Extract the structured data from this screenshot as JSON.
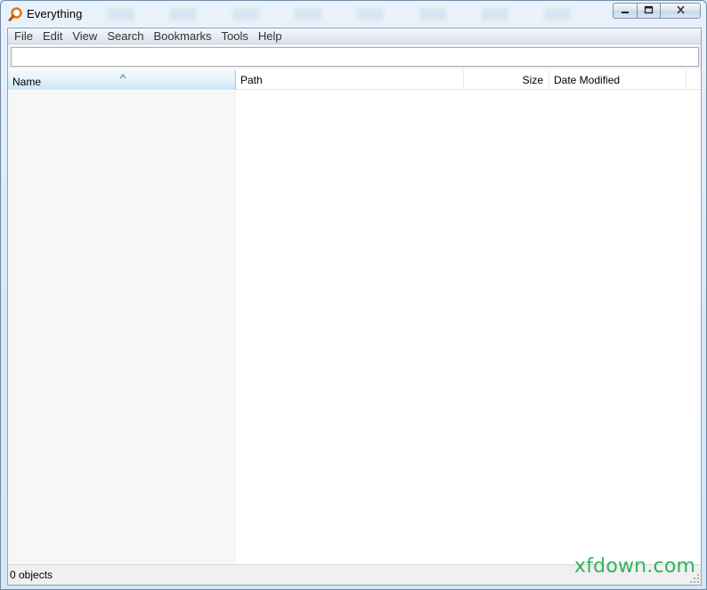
{
  "window": {
    "title": "Everything"
  },
  "caption_buttons": {
    "minimize_icon": "minimize-icon",
    "maximize_icon": "maximize-icon",
    "close_icon": "close-icon"
  },
  "menu": {
    "items": [
      "File",
      "Edit",
      "View",
      "Search",
      "Bookmarks",
      "Tools",
      "Help"
    ]
  },
  "search": {
    "value": "",
    "placeholder": ""
  },
  "columns": {
    "name": "Name",
    "path": "Path",
    "size": "Size",
    "date_modified": "Date Modified",
    "sorted_by": "Name",
    "sort_direction": "ascending"
  },
  "results": [],
  "status": {
    "text": "0 objects"
  },
  "watermark": {
    "text": "xfdown.com"
  },
  "colors": {
    "header_selected": "#c9e7f8",
    "watermark": "#2fb35a",
    "app_icon": "#e8780c"
  }
}
